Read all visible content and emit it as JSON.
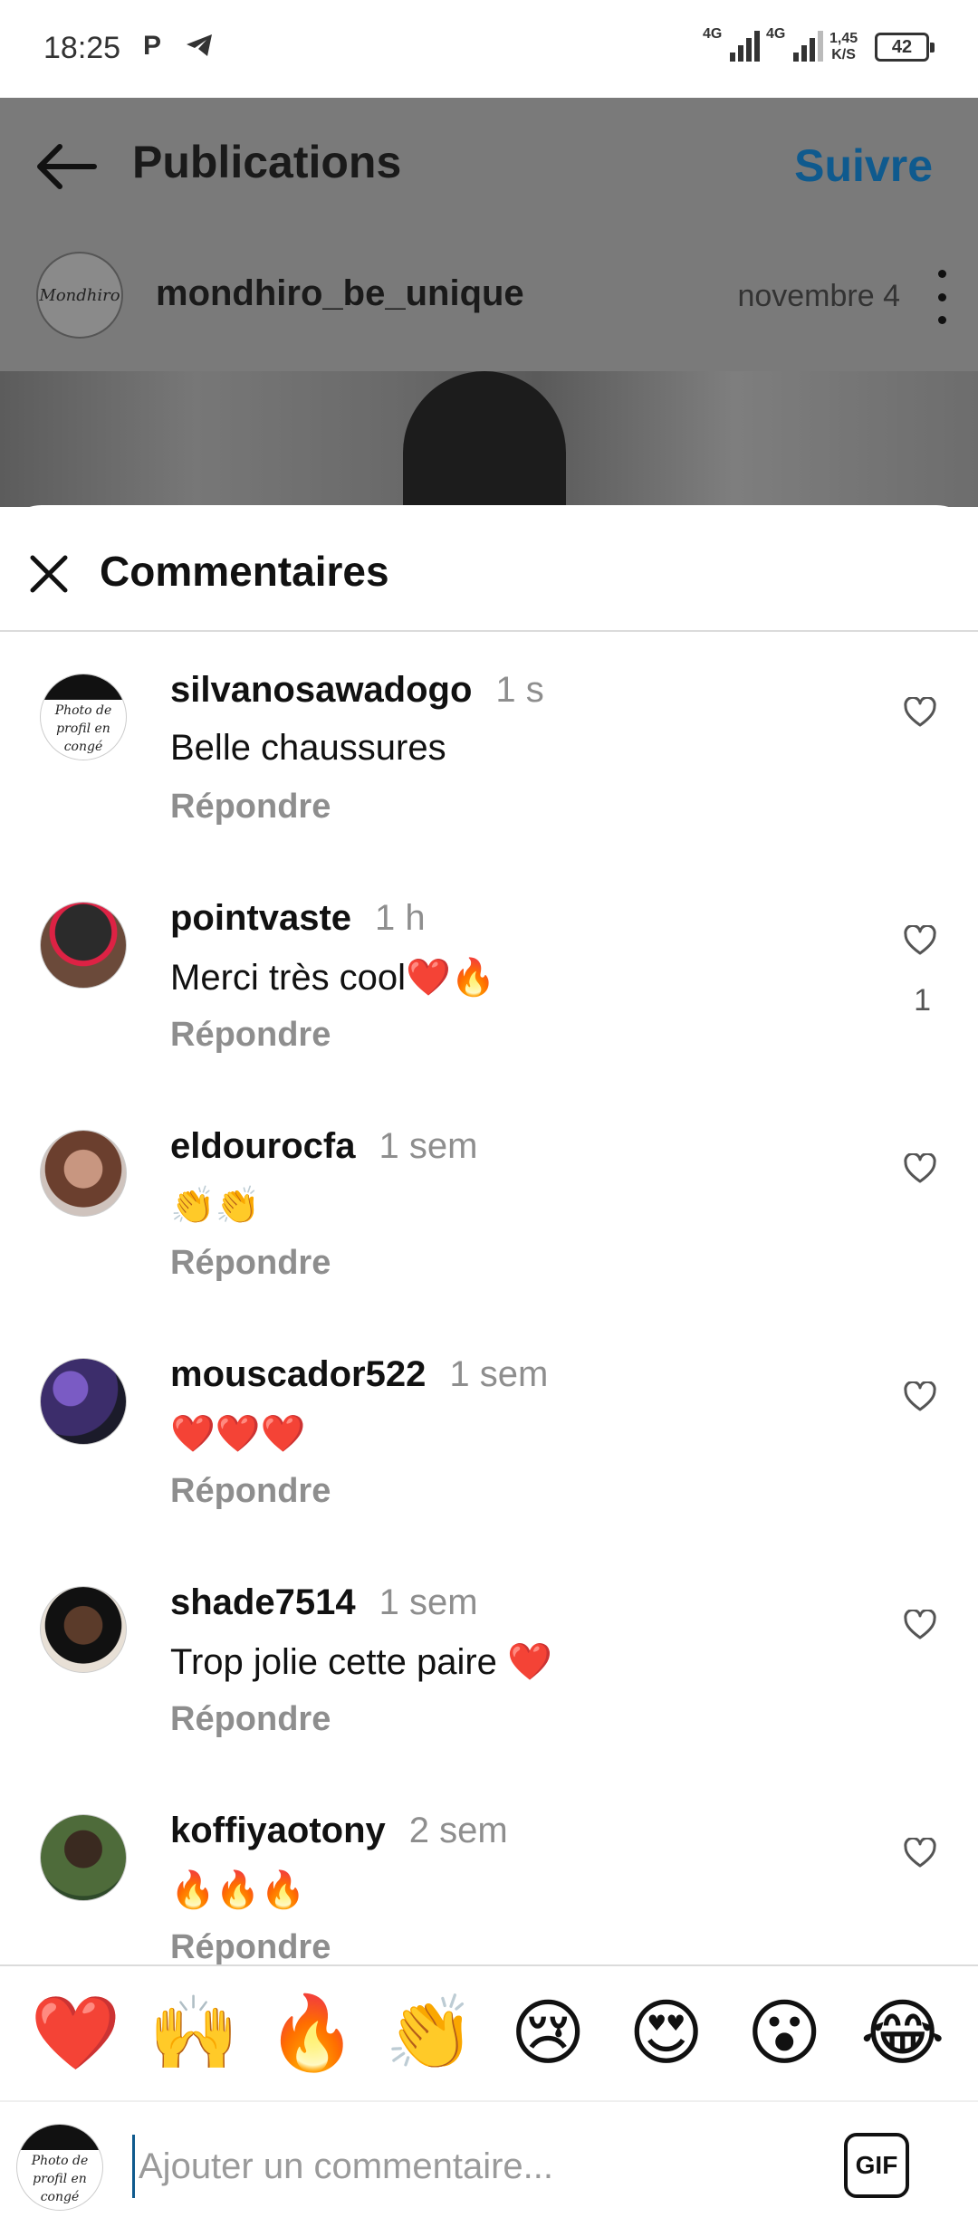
{
  "status_bar": {
    "time": "18:25",
    "notification_letter": "P",
    "network_1": "4G",
    "network_2": "4G",
    "speed_value": "1,45",
    "speed_unit": "K/S",
    "battery": "42"
  },
  "header": {
    "title": "Publications",
    "follow_label": "Suivre"
  },
  "post": {
    "username": "mondhiro_be_unique",
    "date": "novembre 4",
    "avatar_text": "Mondhiro"
  },
  "comments_sheet": {
    "title": "Commentaires",
    "comments": [
      {
        "username": "silvanosawadogo",
        "time": "1 s",
        "text": "Belle chaussures",
        "reply": "Répondre",
        "likes": "",
        "avatar_text": "Photo de profil en congé"
      },
      {
        "username": "pointvaste",
        "time": "1 h",
        "text": "Merci très cool❤️🔥",
        "reply": "Répondre",
        "likes": "1"
      },
      {
        "username": "eldourocfa",
        "time": "1 sem",
        "text": "👏👏",
        "reply": "Répondre",
        "likes": ""
      },
      {
        "username": "mouscador522",
        "time": "1 sem",
        "text": "❤️❤️❤️",
        "reply": "Répondre",
        "likes": ""
      },
      {
        "username": "shade7514",
        "time": "1 sem",
        "text": "Trop jolie cette paire ❤️",
        "reply": "Répondre",
        "likes": ""
      },
      {
        "username": "koffiyaotony",
        "time": "2 sem",
        "text": "🔥🔥🔥",
        "reply": "Répondre",
        "likes": ""
      }
    ]
  },
  "emoji_bar": [
    "❤️",
    "🙌",
    "🔥",
    "👏",
    "😢",
    "😍",
    "😮",
    "😂"
  ],
  "comment_input": {
    "placeholder": "Ajouter un commentaire...",
    "gif_label": "GIF",
    "avatar_text": "Photo de profil en congé"
  },
  "colors": {
    "accent": "#0f5a8e",
    "secondary_text": "#8e8e8e",
    "divider": "#dbdbdb"
  },
  "icons": [
    "telegram-icon",
    "back-arrow-icon",
    "more-options-icon",
    "close-icon",
    "heart-outline-icon"
  ]
}
